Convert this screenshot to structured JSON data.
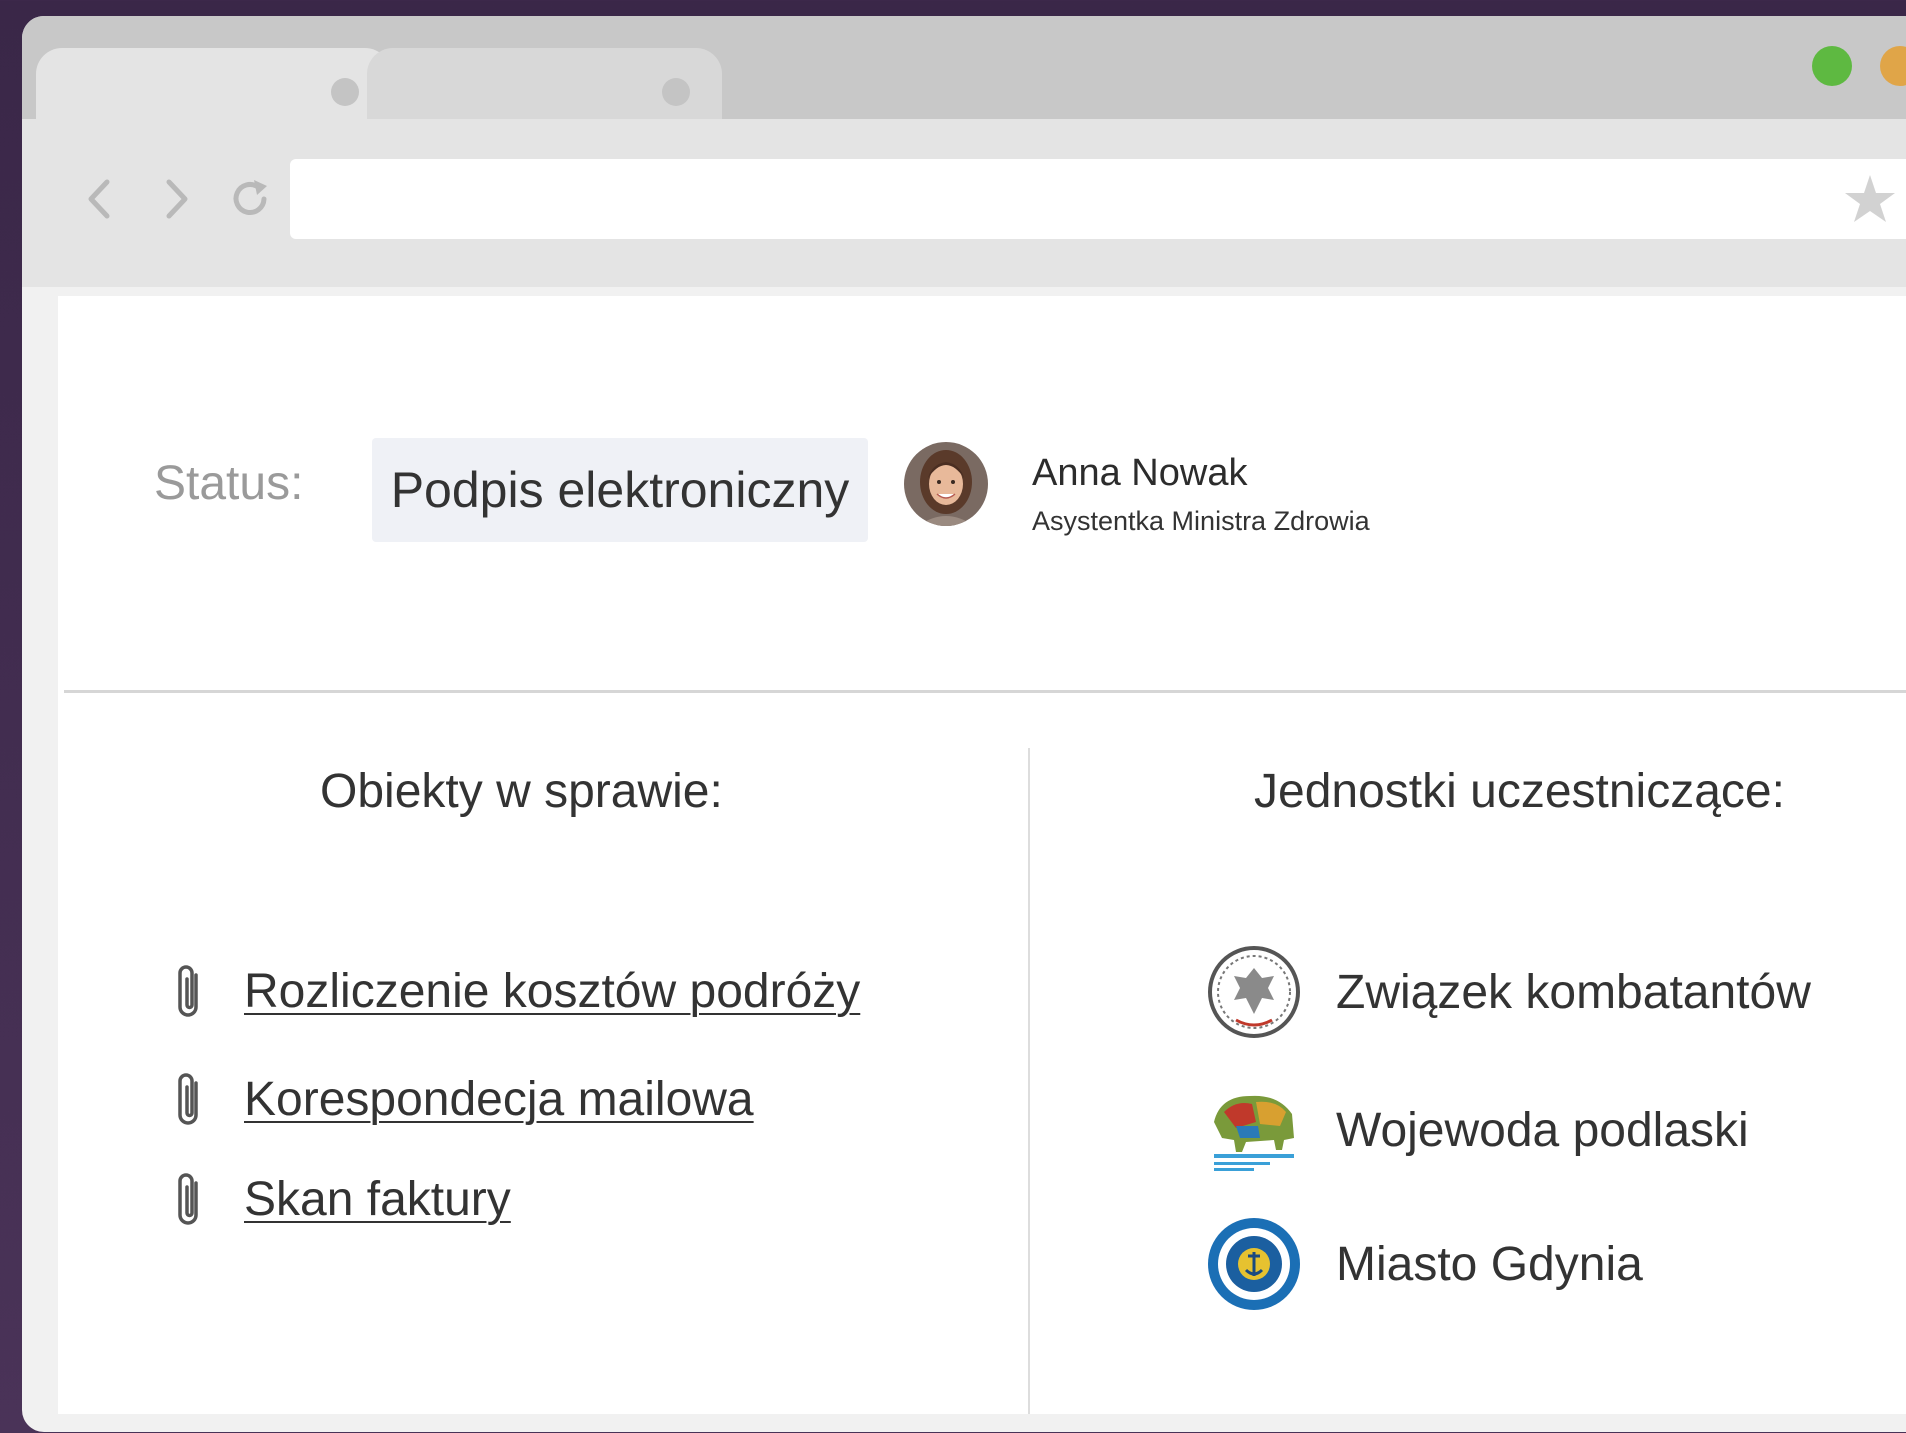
{
  "browser": {
    "tabs": [
      {
        "label": "",
        "active": true
      },
      {
        "label": "",
        "active": false
      }
    ],
    "window_controls": [
      "green-button",
      "orange-button"
    ],
    "address_bar": {
      "value": ""
    },
    "colors": {
      "green": "#5eb941",
      "orange": "#e0a548"
    }
  },
  "status": {
    "label": "Status:",
    "value": "Podpis elektroniczny",
    "person": {
      "name": "Anna Nowak",
      "role": "Asystentka Ministra Zdrowia"
    }
  },
  "objects": {
    "title": "Obiekty w sprawie:",
    "items": [
      {
        "label": "Rozliczenie kosztów podróży",
        "icon": "paperclip-icon"
      },
      {
        "label": "Korespondecja mailowa",
        "icon": "paperclip-icon"
      },
      {
        "label": "Skan faktury",
        "icon": "paperclip-icon"
      }
    ]
  },
  "units": {
    "title": "Jednostki uczestniczące:",
    "items": [
      {
        "label": "Związek kombatantów",
        "icon": "eagle-seal-icon"
      },
      {
        "label": "Wojewoda podlaski",
        "icon": "bison-logo-icon"
      },
      {
        "label": "Miasto Gdynia",
        "icon": "anchor-seal-icon"
      }
    ]
  }
}
